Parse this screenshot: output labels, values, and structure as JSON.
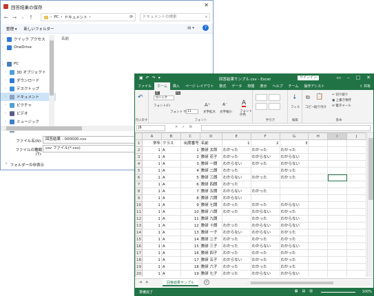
{
  "dialog": {
    "title": "回答結果の保存",
    "path": [
      "PC",
      "ドキュメント"
    ],
    "search_placeholder": "ドキュメントの検索",
    "organize": "整理 ▾",
    "new_folder": "新しいフォルダー",
    "column_name": "名前",
    "nav": [
      {
        "label": "クイック アクセス",
        "icon": "star-icon",
        "color": "#2f7ad6",
        "expand": "›"
      },
      {
        "label": "OneDrive",
        "icon": "cloud-icon",
        "color": "#2f7ad6",
        "expand": "›"
      },
      {
        "label": "",
        "icon": "",
        "color": "",
        "expand": ""
      },
      {
        "label": "PC",
        "icon": "computer-icon",
        "color": "#4a7fb5",
        "expand": "⌄"
      },
      {
        "label": "3D オブジェクト",
        "icon": "cube-icon",
        "color": "#4f9fd6",
        "expand": "›"
      },
      {
        "label": "ダウンロード",
        "icon": "download-icon",
        "color": "#2f7ad6",
        "expand": "›"
      },
      {
        "label": "デスクトップ",
        "icon": "desktop-icon",
        "color": "#3f8fd8",
        "expand": "›"
      },
      {
        "label": "ドキュメント",
        "icon": "documents-icon",
        "color": "#8aa3c2",
        "expand": "›",
        "selected": true
      },
      {
        "label": "ピクチャ",
        "icon": "pictures-icon",
        "color": "#4f9fd6",
        "expand": "›"
      },
      {
        "label": "ビデオ",
        "icon": "video-icon",
        "color": "#5c5c8a",
        "expand": "›"
      },
      {
        "label": "ミュージック",
        "icon": "music-icon",
        "color": "#3f7fc8",
        "expand": "›"
      },
      {
        "label": "OS (C:)",
        "icon": "drive-icon",
        "color": "#7b8fa6",
        "expand": "›"
      }
    ],
    "filename_label": "ファイル名(N):",
    "filename_value": "回答結果 - 000000.csv",
    "filetype_label": "ファイルの種類(T):",
    "filetype_value": "csv ファイル(*.csv)",
    "hide_folders": "フォルダーの非表示"
  },
  "excel": {
    "title": "回答結果サンプル.csv - Excel",
    "signin": "サインイン",
    "tabs": [
      "ファイル",
      "ホーム",
      "挿入",
      "ページ レイアウト",
      "数式",
      "データ",
      "校閲",
      "表示",
      "ヘルプ",
      "チーム"
    ],
    "tell_me": "操作アシスト",
    "share": "共有",
    "ribbon": {
      "undo": "元に戻す",
      "paste": "クリップボード",
      "font_group": "フォント",
      "font_name": "ゴシック",
      "font_size": "11",
      "font_label": "フォント(F)",
      "font_size_label": "フォント サイズ(S)",
      "grow": "文字拡大",
      "shrink": "文字縮小",
      "font_color": "フォントの色",
      "styles_group": "手引き",
      "edit_group": "編集",
      "fill": "フィル",
      "copy": "コピー",
      "paste_label": "貼り付け",
      "cut": "切り取り",
      "overwrite_save": "上書き保存",
      "email": "電子メール",
      "basic_group": "基本"
    },
    "name_box": "J6",
    "columns": [
      "A",
      "B",
      "C",
      "D",
      "E",
      "F",
      "G",
      "H",
      "I",
      "J"
    ],
    "rows": [
      [
        "学年",
        "クラス",
        "出席番号",
        "名前",
        "1",
        "2",
        "3",
        "",
        "",
        ""
      ],
      [
        "1",
        "A",
        "1",
        "教研 太郎",
        "わかった",
        "わかった",
        "わかった",
        "",
        "",
        ""
      ],
      [
        "1",
        "A",
        "2",
        "教研 花子",
        "わかった",
        "わからない",
        "わからない",
        "",
        "",
        ""
      ],
      [
        "1",
        "A",
        "3",
        "教研 一朗",
        "わからない",
        "わかった",
        "わからない",
        "",
        "",
        ""
      ],
      [
        "1",
        "A",
        "4",
        "教研 二朗",
        "わかった",
        "",
        "わかった",
        "",
        "",
        ""
      ],
      [
        "1",
        "A",
        "5",
        "教研 三朗",
        "わからない",
        "わかった",
        "わかった",
        "",
        "",
        ""
      ],
      [
        "1",
        "A",
        "6",
        "教研 四朗",
        "わかった",
        "",
        "",
        "",
        "",
        ""
      ],
      [
        "1",
        "A",
        "7",
        "教研 五朗",
        "わからない",
        "わかった",
        "",
        "",
        "",
        ""
      ],
      [
        "1",
        "A",
        "8",
        "教研 六朗",
        "わからない",
        "",
        "",
        "",
        "",
        ""
      ],
      [
        "1",
        "A",
        "9",
        "教研 七朗",
        "わかった",
        "わかった",
        "わからない",
        "",
        "",
        ""
      ],
      [
        "1",
        "A",
        "10",
        "教研 八朗",
        "わかった",
        "わからない",
        "わかった",
        "",
        "",
        ""
      ],
      [
        "1",
        "A",
        "11",
        "教研 九朗",
        "",
        "わかった",
        "わからない",
        "",
        "",
        ""
      ],
      [
        "1",
        "A",
        "12",
        "教研 十朗",
        "わかった",
        "わからない",
        "わからない",
        "",
        "",
        ""
      ],
      [
        "1",
        "A",
        "13",
        "教研 一子",
        "わからない",
        "わからない",
        "わかった",
        "",
        "",
        ""
      ],
      [
        "1",
        "A",
        "14",
        "教研 二子",
        "わかった",
        "わかった",
        "わかった",
        "",
        "",
        ""
      ],
      [
        "1",
        "A",
        "15",
        "教研 三子",
        "わかった",
        "わからない",
        "わからない",
        "",
        "",
        ""
      ],
      [
        "1",
        "A",
        "16",
        "教研 四子",
        "わかった",
        "わかった",
        "わかった",
        "",
        "",
        ""
      ],
      [
        "1",
        "A",
        "17",
        "教研 五子",
        "わからない",
        "わかった",
        "わかった",
        "",
        "",
        ""
      ],
      [
        "1",
        "A",
        "18",
        "教研 六子",
        "わかった",
        "わかった",
        "わかった",
        "",
        "",
        ""
      ],
      [
        "1",
        "A",
        "19",
        "教研 七子",
        "わかった",
        "わからない",
        "わからない",
        "",
        "",
        ""
      ],
      [
        "1",
        "A",
        "20",
        "教研 八子",
        "わかった",
        "わかった",
        "わかった",
        "",
        "",
        ""
      ]
    ],
    "sheet_tab": "回答結果サンプル",
    "status": "準備完了",
    "zoom": "100%",
    "accent": "#217346"
  }
}
